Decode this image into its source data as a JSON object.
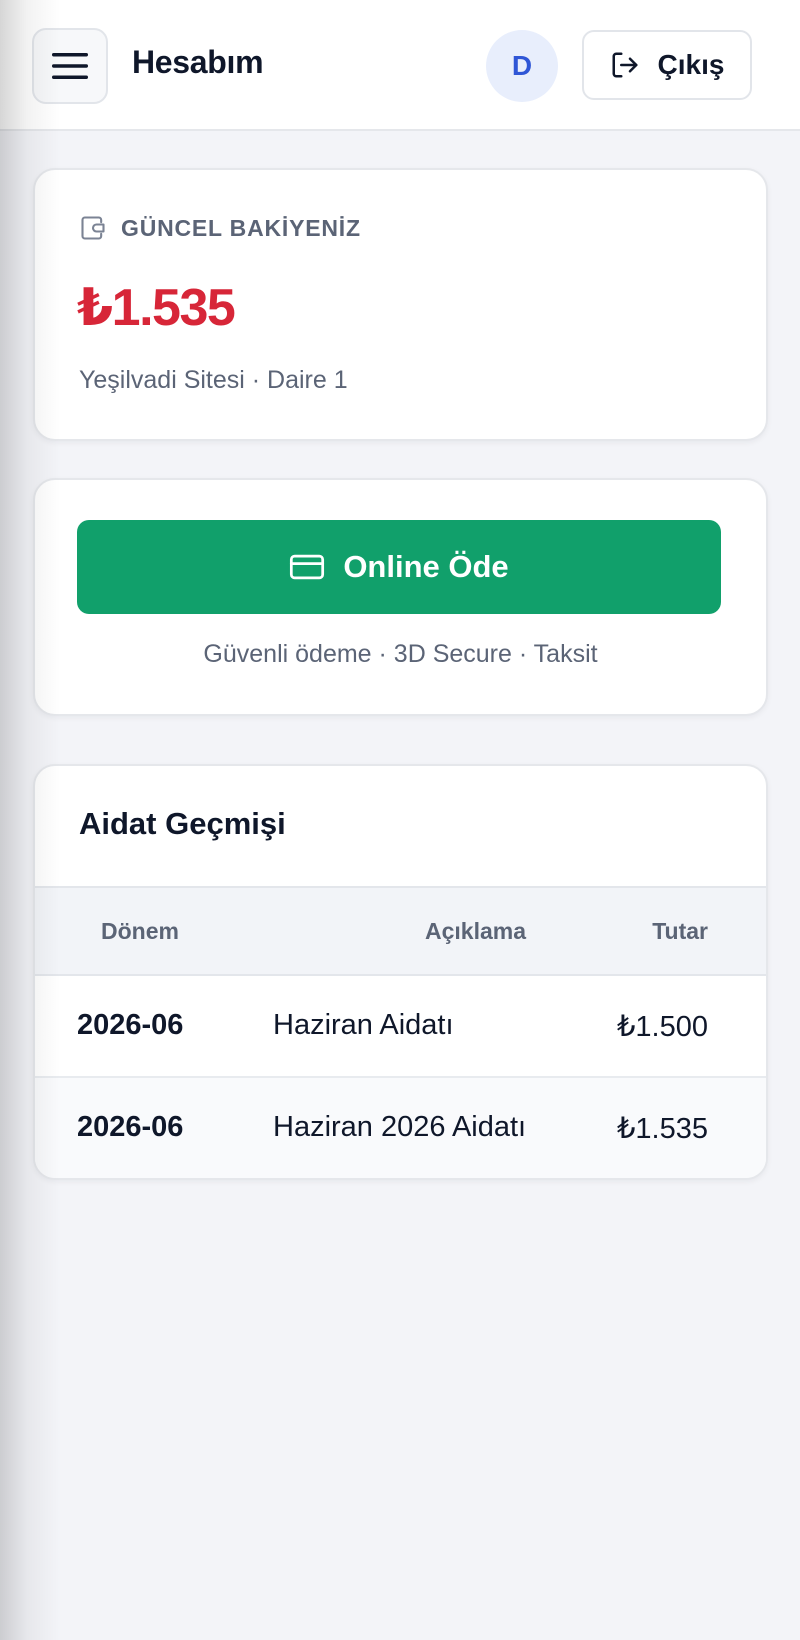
{
  "header": {
    "title": "Hesabım",
    "avatar_initial": "D",
    "logout_label": "Çıkış",
    "icons": {
      "menu": "hamburger-menu-icon",
      "logout": "logout-icon"
    }
  },
  "balance": {
    "label": "GÜNCEL BAKİYENİZ",
    "amount": "₺1.535",
    "subtitle": "Yeşilvadi Sitesi · Daire 1",
    "icon": "wallet-icon",
    "amount_color": "#d72638"
  },
  "payment": {
    "button_label": "Online Öde",
    "icon": "credit-card-icon",
    "note": "Güvenli ödeme · 3D Secure · Taksit",
    "button_color": "#11a06b"
  },
  "history": {
    "title": "Aidat Geçmişi",
    "columns": [
      "Dönem",
      "Açıklama",
      "Tutar"
    ],
    "rows": [
      {
        "period": "2026-06",
        "description": "Haziran Aidatı",
        "amount": "₺1.500"
      },
      {
        "period": "2026-06",
        "description": "Haziran 2026 Aidatı",
        "amount": "₺1.535"
      }
    ]
  }
}
